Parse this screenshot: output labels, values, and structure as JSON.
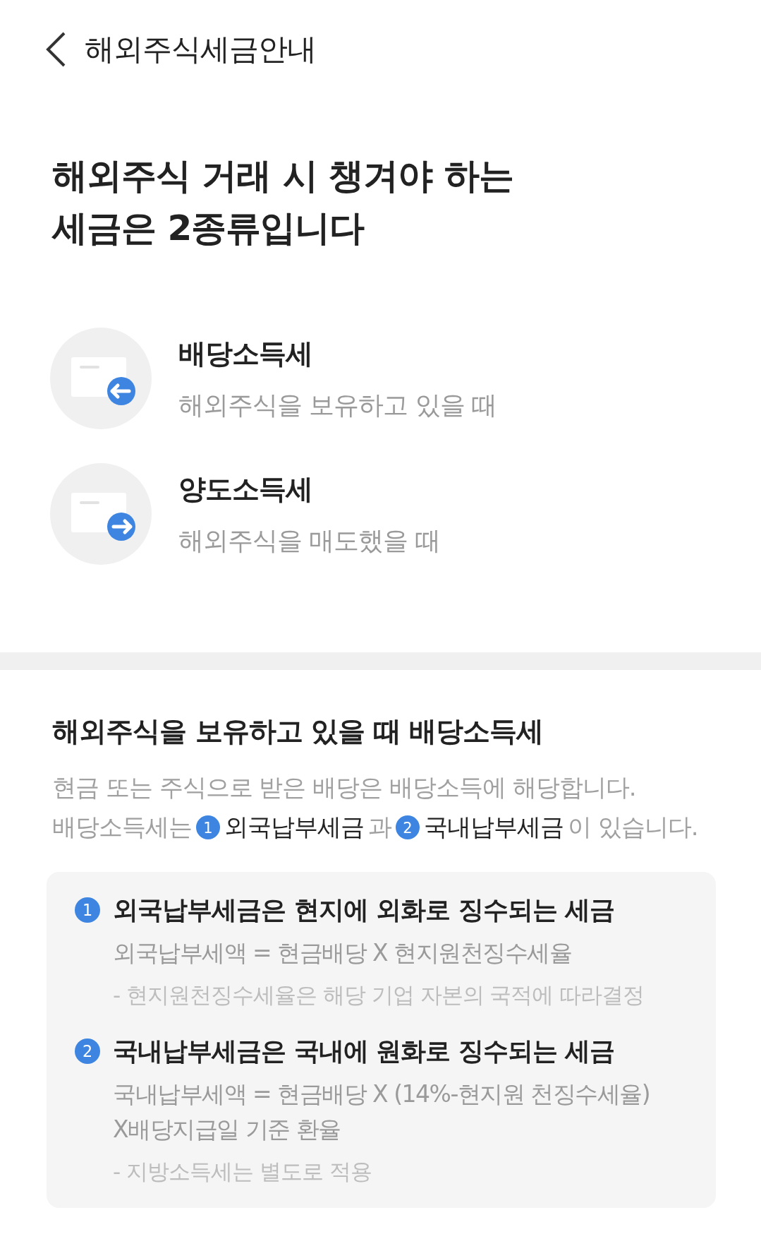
{
  "header": {
    "title": "해외주식세금안내"
  },
  "headline": {
    "lines": [
      "해외주식 거래 시 챙겨야 하는",
      "세금은 2종류입니다"
    ]
  },
  "tax_types": [
    {
      "name": "배당소득세",
      "description": "해외주식을 보유하고 있을 때",
      "kind": "incoming"
    },
    {
      "name": "양도소득세",
      "description": "해외주식을 매도했을 때",
      "kind": "outgoing"
    }
  ],
  "section": {
    "title": "해외주식을 보유하고 있을 때 배당소득세",
    "intro": [
      [
        {
          "kind": "text",
          "text": "현금 또는 주식으로 받은 배당은 배당소득에 해당합니다."
        }
      ],
      [
        {
          "kind": "text",
          "text": "배당소득세는"
        },
        {
          "kind": "badge",
          "text": "1"
        },
        {
          "kind": "term",
          "text": "외국납부세금"
        },
        {
          "kind": "text",
          "text": "과"
        },
        {
          "kind": "badge",
          "text": "2"
        },
        {
          "kind": "term",
          "text": "국내납부세금"
        },
        {
          "kind": "text",
          "text": "이 있습니다."
        }
      ]
    ],
    "items": [
      {
        "number": "1",
        "heading": "외국납부세금은 현지에 외화로 징수되는 세금",
        "formula": [
          "외국납부세액 = 현금배당 X 현지원천징수세율"
        ],
        "note": "- 현지원천징수세율은 해당 기업 자본의 국적에 따라결정"
      },
      {
        "number": "2",
        "heading": "국내납부세금은 국내에 원화로 징수되는 세금",
        "formula": [
          "국내납부세액 = 현금배당 X (14%-현지원 천징수세율)",
          "X배당지급일 기준 환율"
        ],
        "note": "- 지방소득세는 별도로 적용"
      }
    ]
  }
}
